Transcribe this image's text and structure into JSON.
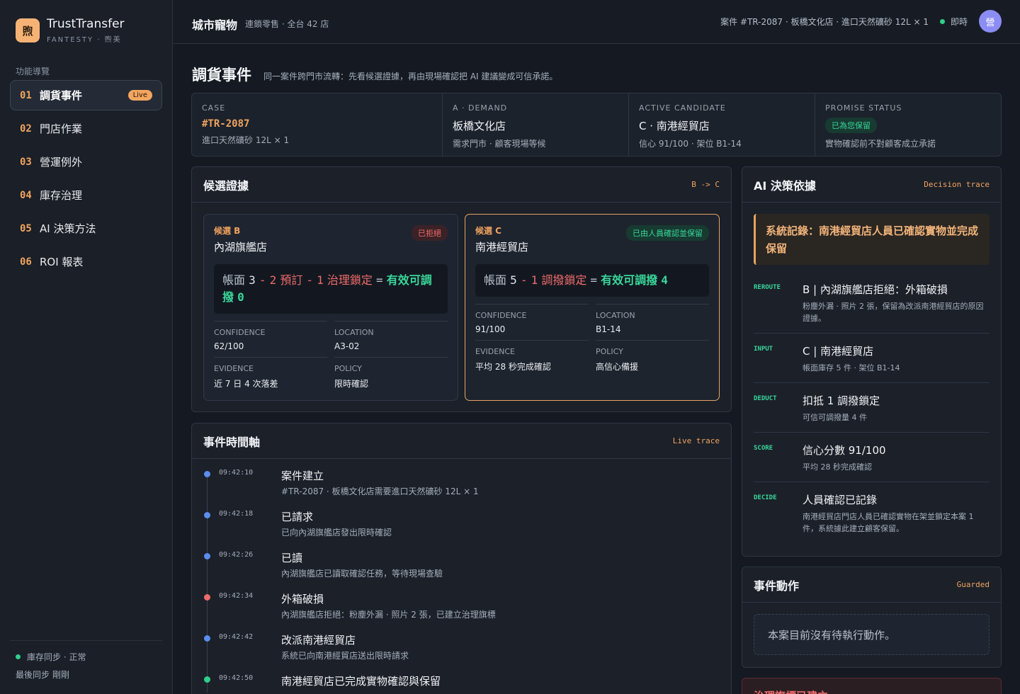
{
  "brand": {
    "logo": "煦",
    "name": "TrustTransfer",
    "sub": "FANTESTY · 煦美"
  },
  "nav": {
    "title": "功能導覽",
    "items": [
      {
        "num": "01",
        "label": "調貨事件",
        "badge": "Live"
      },
      {
        "num": "02",
        "label": "門店作業"
      },
      {
        "num": "03",
        "label": "營運例外"
      },
      {
        "num": "04",
        "label": "庫存治理"
      },
      {
        "num": "05",
        "label": "AI 決策方法"
      },
      {
        "num": "06",
        "label": "ROI 報表"
      }
    ]
  },
  "sync": {
    "status": "庫存同步 · 正常",
    "last": "最後同步 剛剛"
  },
  "header": {
    "title": "城市寵物",
    "subtitle": "連鎖零售 · 全台 42 店",
    "case": "案件 #TR-2087 · 板橋文化店 · 進口天然礦砂 12L × 1",
    "live": "即時",
    "avatar": "營"
  },
  "page": {
    "title": "調貨事件",
    "subtitle": "同一案件跨門市流轉：先看候選證據，再由現場確認把 AI 建議變成可信承諾。"
  },
  "summary": {
    "case": {
      "label": "CASE",
      "value": "#TR-2087",
      "detail": "進口天然礦砂 12L × 1"
    },
    "demand": {
      "label": "A · DEMAND",
      "value": "板橋文化店",
      "detail": "需求門市 · 顧客現場等候"
    },
    "candidate": {
      "label": "ACTIVE CANDIDATE",
      "value": "C · 南港經貿店",
      "detail": "信心 91/100 · 架位 B1-14"
    },
    "promise": {
      "label": "PROMISE STATUS",
      "badge": "已為您保留",
      "detail": "實物確認前不對顧客成立承諾"
    }
  },
  "candidates_panel": {
    "title": "候選證據",
    "tag": "B -> C",
    "b": {
      "tag": "候選 B",
      "name": "內湖旗艦店",
      "status": "已拒絕",
      "formula": {
        "a": "帳面",
        "a_val": "3",
        "minus": "-",
        "b_val": "2",
        "b": "預訂",
        "c_val": "1",
        "c": "治理鎖定",
        "eq": "=",
        "result": "有效可調撥",
        "result_val": "0"
      },
      "facts": [
        {
          "label": "CONFIDENCE",
          "value": "62/100"
        },
        {
          "label": "LOCATION",
          "value": "A3-02"
        },
        {
          "label": "EVIDENCE",
          "value": "近 7 日 4 次落差"
        },
        {
          "label": "POLICY",
          "value": "限時確認"
        }
      ]
    },
    "c": {
      "tag": "候選 C",
      "name": "南港經貿店",
      "status": "已由人員確認並保留",
      "formula": {
        "a": "帳面",
        "a_val": "5",
        "minus": "-",
        "b_val": "1",
        "b": "調撥鎖定",
        "eq": "=",
        "result": "有效可調撥",
        "result_val": "4"
      },
      "facts": [
        {
          "label": "CONFIDENCE",
          "value": "91/100"
        },
        {
          "label": "LOCATION",
          "value": "B1-14"
        },
        {
          "label": "EVIDENCE",
          "value": "平均 28 秒完成確認"
        },
        {
          "label": "POLICY",
          "value": "高信心備援"
        }
      ]
    }
  },
  "timeline": {
    "title": "事件時間軸",
    "tag": "Live trace",
    "items": [
      {
        "time": "09:42:10",
        "title": "案件建立",
        "desc": "#TR-2087 · 板橋文化店需要進口天然礦砂 12L × 1",
        "color": "#5b8def"
      },
      {
        "time": "09:42:18",
        "title": "已請求",
        "desc": "已向內湖旗艦店發出限時確認",
        "color": "#5b8def"
      },
      {
        "time": "09:42:26",
        "title": "已讀",
        "desc": "內湖旗艦店已讀取確認任務，等待現場查驗",
        "color": "#5b8def"
      },
      {
        "time": "09:42:34",
        "title": "外箱破損",
        "desc": "內湖旗艦店拒絕：粉塵外漏 · 照片 2 張，已建立治理旗標",
        "color": "#ee6b6b"
      },
      {
        "time": "09:42:42",
        "title": "改派南港經貿店",
        "desc": "系統已向南港經貿店送出限時請求",
        "color": "#5b8def"
      },
      {
        "time": "09:42:50",
        "title": "南港經貿店已完成實物確認與保留",
        "desc": "",
        "color": "#2fcf8b"
      }
    ]
  },
  "ai": {
    "title": "AI 決策依據",
    "tag": "Decision trace",
    "callout": "系統記錄：南港經貿店人員已確認實物並完成保留",
    "steps": [
      {
        "key": "REROUTE",
        "title": "B | 內湖旗艦店拒絕：外箱破損",
        "desc": "粉塵外漏 · 照片 2 張，保留為改派南港經貿店的原因證據。"
      },
      {
        "key": "INPUT",
        "title": "C | 南港經貿店",
        "desc": "帳面庫存 5 件 · 架位 B1-14"
      },
      {
        "key": "DEDUCT",
        "title": "扣抵 1 調撥鎖定",
        "desc": "可信可調撥量 4 件"
      },
      {
        "key": "SCORE",
        "title": "信心分數 91/100",
        "desc": "平均 28 秒完成確認"
      },
      {
        "key": "DECIDE",
        "title": "人員確認已記錄",
        "desc": "南港經貿店門店人員已確認實物在架並鎖定本案 1 件，系統據此建立顧客保留。"
      }
    ]
  },
  "actions": {
    "title": "事件動作",
    "tag": "Guarded",
    "empty": "本案目前沒有待執行動作。"
  },
  "governance": {
    "title": "治理旗標已建立"
  }
}
